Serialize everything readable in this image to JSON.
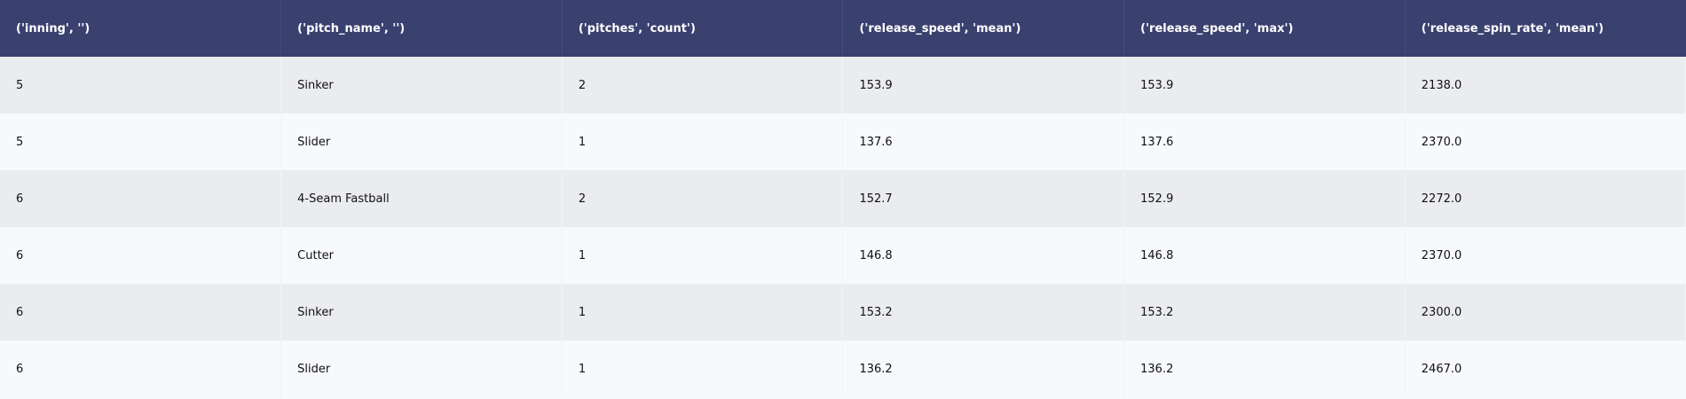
{
  "table": {
    "headers": [
      "('inning', '')",
      "('pitch_name', '')",
      "('pitches', 'count')",
      "('release_speed', 'mean')",
      "('release_speed', 'max')",
      "('release_spin_rate', 'mean')"
    ],
    "rows": [
      [
        "5",
        "Sinker",
        "2",
        "153.9",
        "153.9",
        "2138.0"
      ],
      [
        "5",
        "Slider",
        "1",
        "137.6",
        "137.6",
        "2370.0"
      ],
      [
        "6",
        "4-Seam Fastball",
        "2",
        "152.7",
        "152.9",
        "2272.0"
      ],
      [
        "6",
        "Cutter",
        "1",
        "146.8",
        "146.8",
        "2370.0"
      ],
      [
        "6",
        "Sinker",
        "1",
        "153.2",
        "153.2",
        "2300.0"
      ],
      [
        "6",
        "Slider",
        "1",
        "136.2",
        "136.2",
        "2467.0"
      ]
    ]
  },
  "colors": {
    "header_bg": "#3a416f",
    "row_even_bg": "#ebecef",
    "row_odd_bg": "#f7f9fd"
  }
}
